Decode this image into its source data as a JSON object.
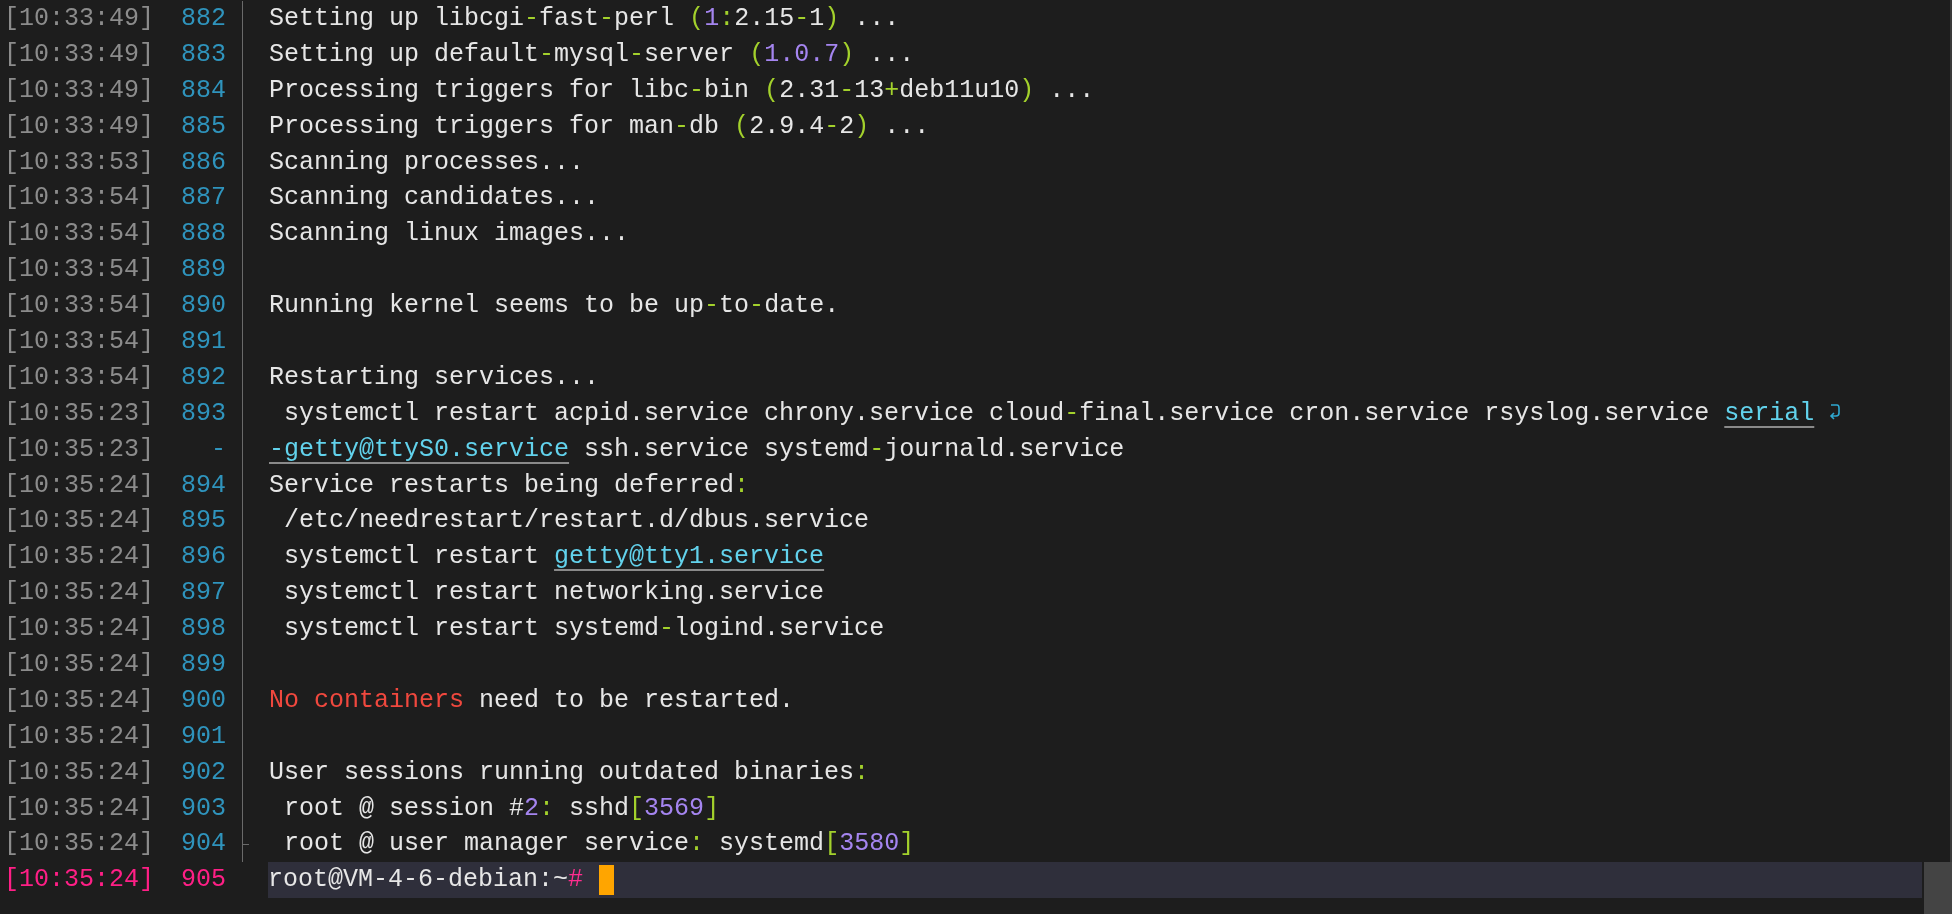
{
  "lines": [
    {
      "time": "[10:33:49]",
      "number": "882",
      "segments": [
        {
          "text": "Setting up libcgi",
          "kind": "t"
        },
        {
          "text": "-",
          "kind": "p"
        },
        {
          "text": "fast",
          "kind": "t"
        },
        {
          "text": "-",
          "kind": "p"
        },
        {
          "text": "perl ",
          "kind": "t"
        },
        {
          "text": "(",
          "kind": "p"
        },
        {
          "text": "1",
          "kind": "n"
        },
        {
          "text": ":",
          "kind": "p"
        },
        {
          "text": "2.15",
          "kind": "t"
        },
        {
          "text": "-",
          "kind": "p"
        },
        {
          "text": "1",
          "kind": "t"
        },
        {
          "text": ")",
          "kind": "p"
        },
        {
          "text": " ...",
          "kind": "t"
        }
      ]
    },
    {
      "time": "[10:33:49]",
      "number": "883",
      "segments": [
        {
          "text": "Setting up default",
          "kind": "t"
        },
        {
          "text": "-",
          "kind": "p"
        },
        {
          "text": "mysql",
          "kind": "t"
        },
        {
          "text": "-",
          "kind": "p"
        },
        {
          "text": "server ",
          "kind": "t"
        },
        {
          "text": "(",
          "kind": "p"
        },
        {
          "text": "1.0.7",
          "kind": "n"
        },
        {
          "text": ")",
          "kind": "p"
        },
        {
          "text": " ...",
          "kind": "t"
        }
      ]
    },
    {
      "time": "[10:33:49]",
      "number": "884",
      "segments": [
        {
          "text": "Processing triggers for libc",
          "kind": "t"
        },
        {
          "text": "-",
          "kind": "p"
        },
        {
          "text": "bin ",
          "kind": "t"
        },
        {
          "text": "(",
          "kind": "p"
        },
        {
          "text": "2.31",
          "kind": "t"
        },
        {
          "text": "-",
          "kind": "p"
        },
        {
          "text": "13",
          "kind": "t"
        },
        {
          "text": "+",
          "kind": "p"
        },
        {
          "text": "deb11u10",
          "kind": "t"
        },
        {
          "text": ")",
          "kind": "p"
        },
        {
          "text": " ...",
          "kind": "t"
        }
      ]
    },
    {
      "time": "[10:33:49]",
      "number": "885",
      "segments": [
        {
          "text": "Processing triggers for man",
          "kind": "t"
        },
        {
          "text": "-",
          "kind": "p"
        },
        {
          "text": "db ",
          "kind": "t"
        },
        {
          "text": "(",
          "kind": "p"
        },
        {
          "text": "2.9.4",
          "kind": "t"
        },
        {
          "text": "-",
          "kind": "p"
        },
        {
          "text": "2",
          "kind": "t"
        },
        {
          "text": ")",
          "kind": "p"
        },
        {
          "text": " ...",
          "kind": "t"
        }
      ]
    },
    {
      "time": "[10:33:53]",
      "number": "886",
      "segments": [
        {
          "text": "Scanning processes...",
          "kind": "t"
        }
      ]
    },
    {
      "time": "[10:33:54]",
      "number": "887",
      "segments": [
        {
          "text": "Scanning candidates...",
          "kind": "t"
        }
      ]
    },
    {
      "time": "[10:33:54]",
      "number": "888",
      "segments": [
        {
          "text": "Scanning linux images...",
          "kind": "t"
        }
      ]
    },
    {
      "time": "[10:33:54]",
      "number": "889"
    },
    {
      "time": "[10:33:54]",
      "number": "890",
      "segments": [
        {
          "text": "Running kernel seems to be up",
          "kind": "t"
        },
        {
          "text": "-",
          "kind": "p"
        },
        {
          "text": "to",
          "kind": "t"
        },
        {
          "text": "-",
          "kind": "p"
        },
        {
          "text": "date.",
          "kind": "t"
        }
      ]
    },
    {
      "time": "[10:33:54]",
      "number": "891"
    },
    {
      "time": "[10:33:54]",
      "number": "892",
      "segments": [
        {
          "text": "Restarting services...",
          "kind": "t"
        }
      ]
    },
    {
      "time": "[10:35:23]",
      "number": "893",
      "wrapped": true,
      "segments": [
        {
          "text": " systemctl restart acpid.service chrony.service cloud",
          "kind": "t"
        },
        {
          "text": "-",
          "kind": "p"
        },
        {
          "text": "final.service cron.service rsyslog.service ",
          "kind": "t"
        },
        {
          "text": "serial",
          "kind": "l"
        }
      ]
    },
    {
      "time": "[10:35:23]",
      "number": "-",
      "segments": [
        {
          "text": "-getty@ttyS0.service",
          "kind": "l"
        },
        {
          "text": " ssh.service systemd",
          "kind": "t"
        },
        {
          "text": "-",
          "kind": "p"
        },
        {
          "text": "journald.service",
          "kind": "t"
        }
      ]
    },
    {
      "time": "[10:35:24]",
      "number": "894",
      "segments": [
        {
          "text": "Service restarts being deferred",
          "kind": "t"
        },
        {
          "text": ":",
          "kind": "p"
        }
      ]
    },
    {
      "time": "[10:35:24]",
      "number": "895",
      "segments": [
        {
          "text": " /etc/needrestart/restart.d/dbus.service",
          "kind": "t"
        }
      ]
    },
    {
      "time": "[10:35:24]",
      "number": "896",
      "segments": [
        {
          "text": " systemctl restart ",
          "kind": "t"
        },
        {
          "text": "getty@tty1.service",
          "kind": "l"
        }
      ]
    },
    {
      "time": "[10:35:24]",
      "number": "897",
      "segments": [
        {
          "text": " systemctl restart networking.service",
          "kind": "t"
        }
      ]
    },
    {
      "time": "[10:35:24]",
      "number": "898",
      "segments": [
        {
          "text": " systemctl restart systemd",
          "kind": "t"
        },
        {
          "text": "-",
          "kind": "p"
        },
        {
          "text": "logind.service",
          "kind": "t"
        }
      ]
    },
    {
      "time": "[10:35:24]",
      "number": "899"
    },
    {
      "time": "[10:35:24]",
      "number": "900",
      "segments": [
        {
          "text": "No containers",
          "kind": "e"
        },
        {
          "text": " need to be restarted.",
          "kind": "t"
        }
      ]
    },
    {
      "time": "[10:35:24]",
      "number": "901"
    },
    {
      "time": "[10:35:24]",
      "number": "902",
      "segments": [
        {
          "text": "User sessions running outdated binaries",
          "kind": "t"
        },
        {
          "text": ":",
          "kind": "p"
        }
      ]
    },
    {
      "time": "[10:35:24]",
      "number": "903",
      "segments": [
        {
          "text": " root @ session #",
          "kind": "t"
        },
        {
          "text": "2",
          "kind": "n"
        },
        {
          "text": ":",
          "kind": "p"
        },
        {
          "text": " sshd",
          "kind": "t"
        },
        {
          "text": "[",
          "kind": "p"
        },
        {
          "text": "3569",
          "kind": "n"
        },
        {
          "text": "]",
          "kind": "p"
        }
      ]
    },
    {
      "time": "[10:35:24]",
      "number": "904",
      "segments": [
        {
          "text": " root @ user manager service",
          "kind": "t"
        },
        {
          "text": ":",
          "kind": "p"
        },
        {
          "text": " systemd",
          "kind": "t"
        },
        {
          "text": "[",
          "kind": "p"
        },
        {
          "text": "3580",
          "kind": "n"
        },
        {
          "text": "]",
          "kind": "p"
        }
      ]
    }
  ],
  "prompt": {
    "time": "[10:35:24]",
    "number": "905",
    "selected": true,
    "cursor": true,
    "segments": [
      {
        "text": "root@VM-4-6-debian:~",
        "kind": "t"
      },
      {
        "text": "#",
        "kind": "h"
      }
    ]
  }
}
